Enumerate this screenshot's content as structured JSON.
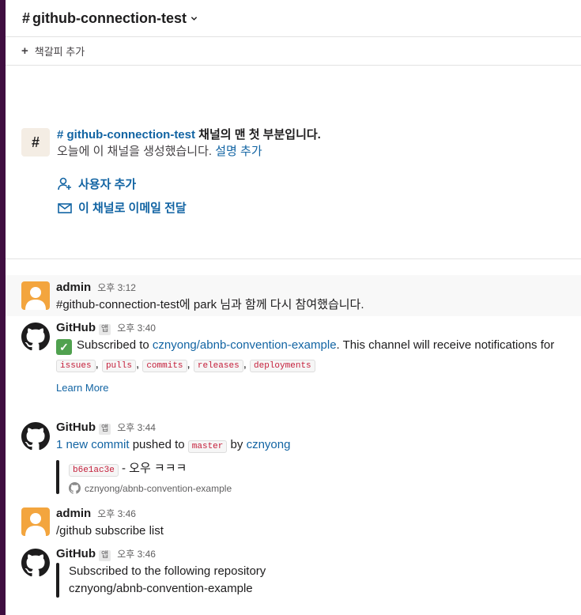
{
  "header": {
    "hash": "#",
    "channel_name": "github-connection-test"
  },
  "bookmark": {
    "plus": "+",
    "label": "책갈피 추가"
  },
  "intro": {
    "icon_hash": "#",
    "channel_link": "# github-connection-test",
    "title_rest": " 채널의 맨 첫 부분입니다.",
    "created_text": "오늘에 이 채널을 생성했습니다. ",
    "add_description": "설명 추가",
    "add_user": "사용자 추가",
    "email_forward": "이 채널로 이메일 전달"
  },
  "messages": [
    {
      "sender": "admin",
      "time": "오후 3:12",
      "text": "#github-connection-test에 park 님과 함께 다시 참여했습니다."
    },
    {
      "sender": "GitHub",
      "badge": "앱",
      "time": "오후 3:40",
      "text_prefix": "Subscribed to ",
      "repo_link": "cznyong/abnb-convention-example",
      "text_suffix": ". This channel will receive notifications for",
      "features": [
        "issues",
        "pulls",
        "commits",
        "releases",
        "deployments"
      ],
      "sep": ",",
      "learn_more": "Learn More"
    },
    {
      "sender": "GitHub",
      "badge": "앱",
      "time": "오후 3:44",
      "commit_link": "1 new commit",
      "pushed_to": " pushed to ",
      "branch": "master",
      "by": " by ",
      "author": "cznyong",
      "commit_hash": "b6e1ac3e",
      "commit_msg": " - 오우 ㅋㅋㅋ",
      "repo": "cznyong/abnb-convention-example"
    },
    {
      "sender": "admin",
      "time": "오후 3:46",
      "text": "/github subscribe list"
    },
    {
      "sender": "GitHub",
      "badge": "앱",
      "time": "오후 3:46",
      "list_title": "Subscribed to the following repository",
      "repo_link": "cznyong/abnb-convention-example"
    }
  ],
  "colors": {
    "sidebar": "#3f0e40",
    "link": "#1264a3",
    "admin_avatar": "#f3a53e",
    "highlight": "#f8f8f8"
  },
  "icons": [
    "chevron-down-icon",
    "plus-icon",
    "hash-icon",
    "add-user-icon",
    "email-icon",
    "person-avatar-icon",
    "github-icon",
    "check-icon"
  ]
}
